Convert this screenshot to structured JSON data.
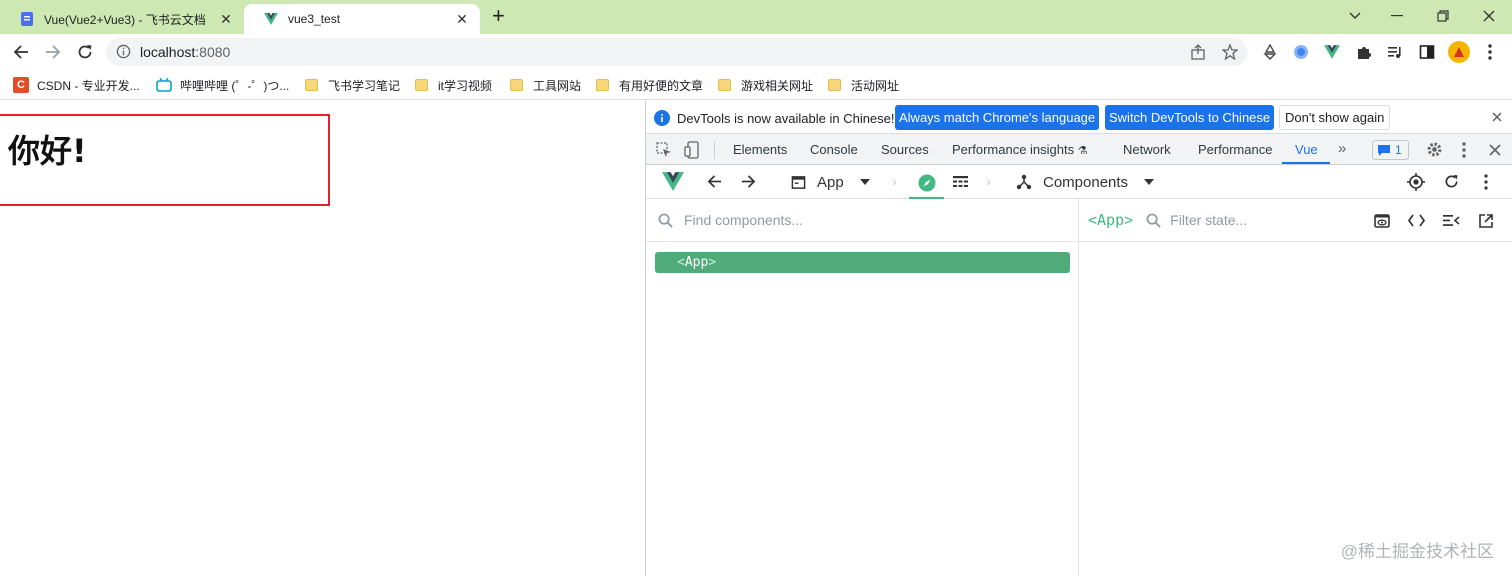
{
  "browser": {
    "tabs": [
      {
        "title": "Vue(Vue2+Vue3) - 飞书云文档",
        "icon": "document-icon",
        "active": false
      },
      {
        "title": "vue3_test",
        "icon": "vue-logo-icon",
        "active": true
      }
    ],
    "new_tab_symbol": "+",
    "url_host": "localhost",
    "url_port": ":8080",
    "bookmarks": [
      {
        "label": "CSDN - 专业开发...",
        "icon": "csdn-icon"
      },
      {
        "label": "哔哩哔哩 (゜-゜)つ...",
        "icon": "bilibili-icon"
      },
      {
        "label": "飞书学习笔记",
        "icon": "folder-icon"
      },
      {
        "label": "it学习视频",
        "icon": "folder-icon"
      },
      {
        "label": "工具网站",
        "icon": "folder-icon"
      },
      {
        "label": "有用好便的文章",
        "icon": "folder-icon"
      },
      {
        "label": "游戏相关网址",
        "icon": "folder-icon"
      },
      {
        "label": "活动网址",
        "icon": "folder-icon"
      }
    ]
  },
  "page": {
    "heading": "你好!"
  },
  "devtools": {
    "infobar": {
      "message": "DevTools is now available in Chinese!",
      "btn_match": "Always match Chrome's language",
      "btn_switch": "Switch DevTools to Chinese",
      "btn_dismiss": "Don't show again"
    },
    "tabs": [
      "Elements",
      "Console",
      "Sources",
      "Performance insights",
      "Network",
      "Performance",
      "Vue"
    ],
    "selected_tab": "Vue",
    "issues_count": "1",
    "vue": {
      "app_selector": "App",
      "view_selector": "Components",
      "find_placeholder": "Find components...",
      "filter_placeholder": "Filter state...",
      "selected_component": "<App>",
      "tree_component": "App",
      "tree_open": "<",
      "tree_close": ">"
    }
  },
  "watermark": "@稀土掘金技术社区",
  "colors": {
    "titlebar": "#cde8b3",
    "vue_green": "#42b883",
    "selected_row": "#4fac7a",
    "devtools_accent": "#1a73e8",
    "heading_border": "#e0222a"
  }
}
